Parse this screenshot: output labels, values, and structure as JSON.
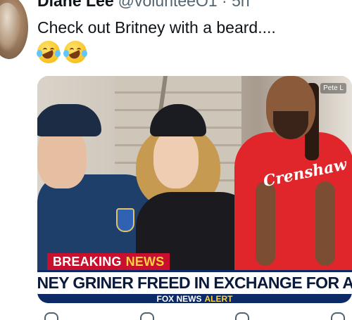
{
  "tweet": {
    "author_name": "Diane Lee",
    "author_handle": "@volunteeO1",
    "time_separator": "·",
    "time": "5h",
    "text": "Check out Britney with a beard....",
    "emoji_icons": [
      "rolling-on-the-floor-laughing-icon",
      "rolling-on-the-floor-laughing-icon"
    ]
  },
  "media": {
    "watermark": "Pete L",
    "shirt_logo": "Crenshaw",
    "banner": {
      "breaking_label": "BREAKING",
      "news_label": "NEWS",
      "headline": "BRITNEY GRINER FREED IN EXCHANGE FOR ARMS",
      "network": "FOX NEWS",
      "alert": "ALERT"
    }
  },
  "actions": [
    "reply-icon",
    "retweet-icon",
    "like-icon",
    "share-icon"
  ],
  "colors": {
    "breaking_red": "#c8102e",
    "banner_navy": "#0c2a66",
    "alert_yellow": "#ffd23f"
  }
}
